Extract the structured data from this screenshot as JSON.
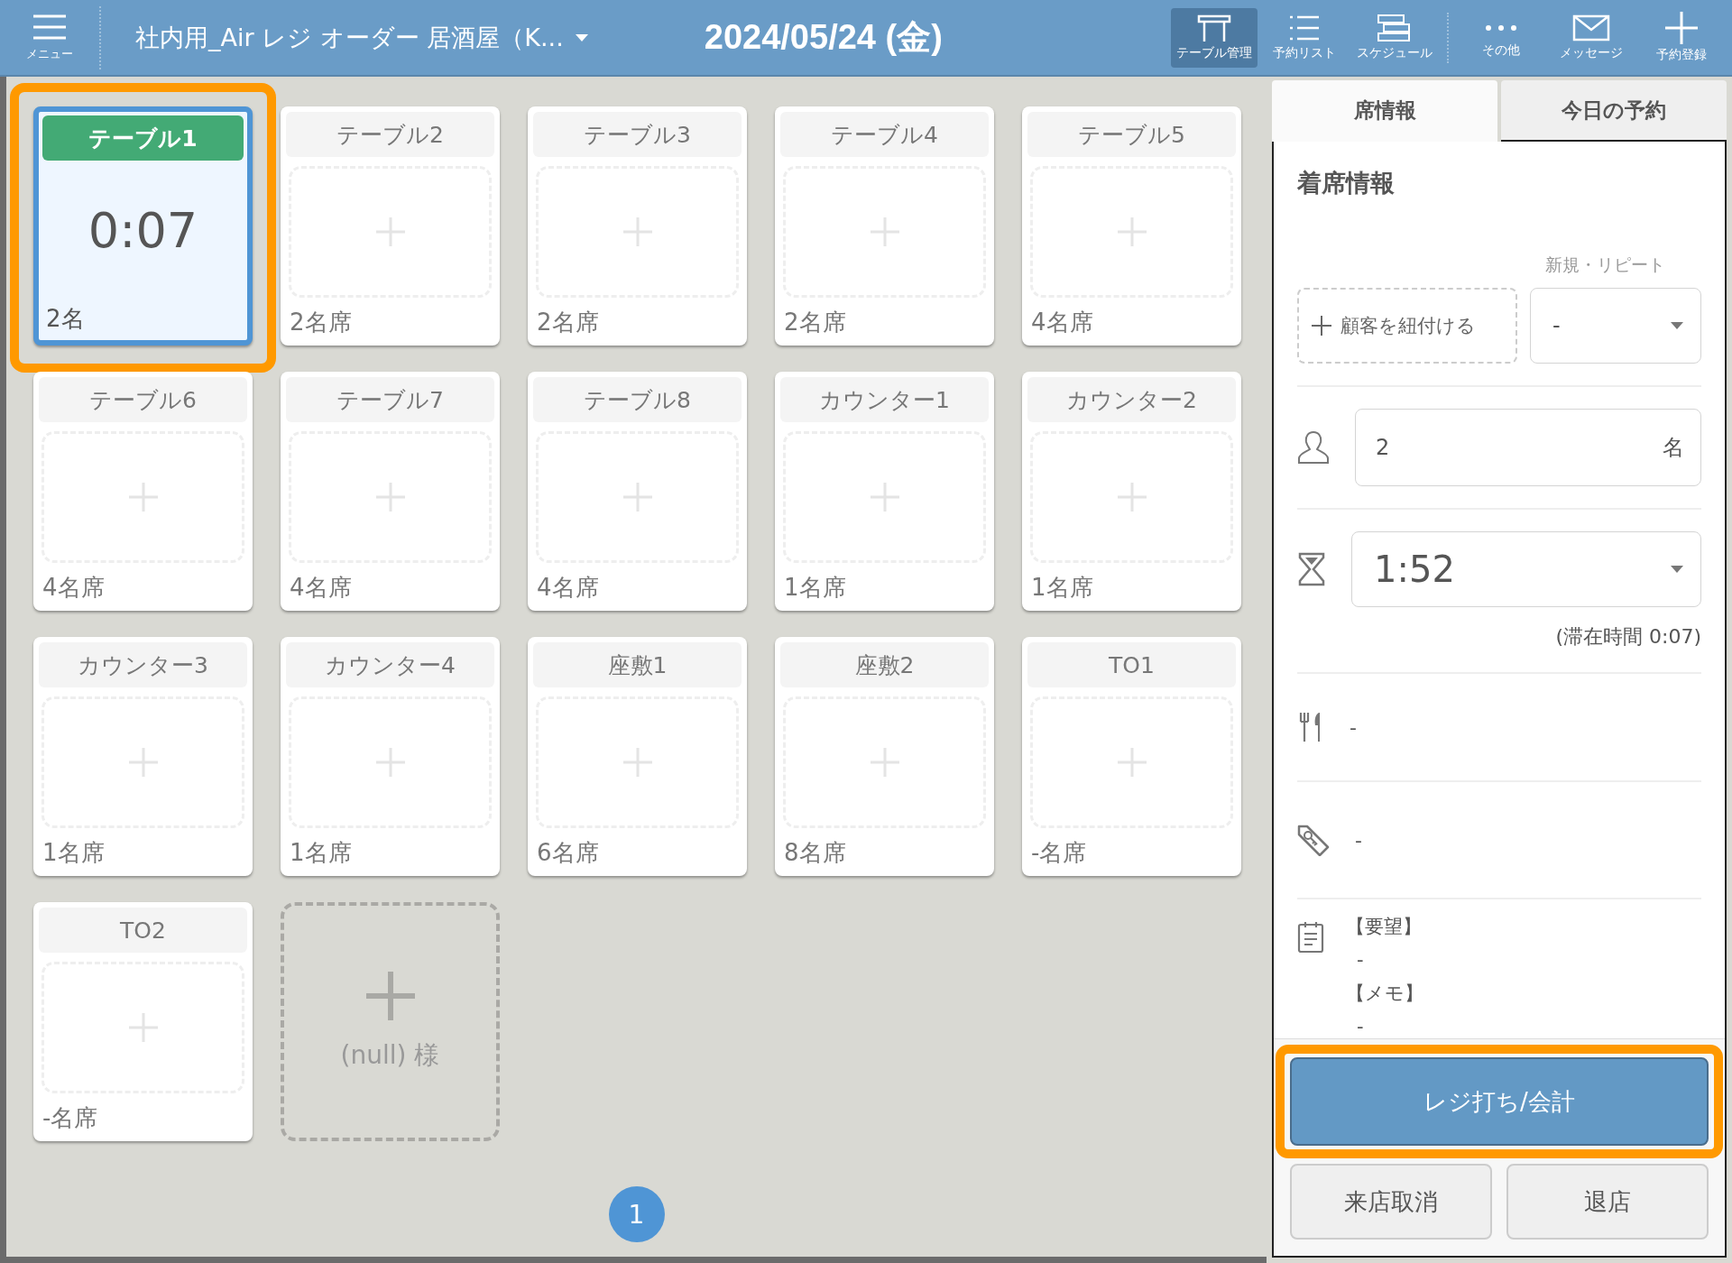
{
  "header": {
    "menu_label": "メニュー",
    "store": "社内用_Air レジ オーダー 居酒屋（K...",
    "date": "2024/05/24 (金)",
    "tools": [
      {
        "label": "テーブル管理",
        "kind": "table",
        "selected": true
      },
      {
        "label": "予約リスト",
        "kind": "list",
        "selected": false
      },
      {
        "label": "スケジュール",
        "kind": "schedule",
        "selected": false
      },
      {
        "label": "その他",
        "kind": "more",
        "selected": false
      },
      {
        "label": "メッセージ",
        "kind": "message",
        "selected": false
      },
      {
        "label": "予約登録",
        "kind": "add",
        "selected": false
      }
    ]
  },
  "tables": [
    {
      "name": "テーブル1",
      "kind": "occupied",
      "elapsed": "0:07",
      "footer": "2名",
      "selected": true,
      "highlighted": true
    },
    {
      "name": "テーブル2",
      "kind": "empty",
      "footer": "2名席",
      "selected": false,
      "highlighted": false
    },
    {
      "name": "テーブル3",
      "kind": "empty",
      "footer": "2名席",
      "selected": false,
      "highlighted": false
    },
    {
      "name": "テーブル4",
      "kind": "empty",
      "footer": "2名席",
      "selected": false,
      "highlighted": false
    },
    {
      "name": "テーブル5",
      "kind": "empty",
      "footer": "4名席",
      "selected": false,
      "highlighted": false
    },
    {
      "name": "テーブル6",
      "kind": "empty",
      "footer": "4名席",
      "selected": false,
      "highlighted": false
    },
    {
      "name": "テーブル7",
      "kind": "empty",
      "footer": "4名席",
      "selected": false,
      "highlighted": false
    },
    {
      "name": "テーブル8",
      "kind": "empty",
      "footer": "4名席",
      "selected": false,
      "highlighted": false
    },
    {
      "name": "カウンター1",
      "kind": "empty",
      "footer": "1名席",
      "selected": false,
      "highlighted": false
    },
    {
      "name": "カウンター2",
      "kind": "empty",
      "footer": "1名席",
      "selected": false,
      "highlighted": false
    },
    {
      "name": "カウンター3",
      "kind": "empty",
      "footer": "1名席",
      "selected": false,
      "highlighted": false
    },
    {
      "name": "カウンター4",
      "kind": "empty",
      "footer": "1名席",
      "selected": false,
      "highlighted": false
    },
    {
      "name": "座敷1",
      "kind": "empty",
      "footer": "6名席",
      "selected": false,
      "highlighted": false
    },
    {
      "name": "座敷2",
      "kind": "empty",
      "footer": "8名席",
      "selected": false,
      "highlighted": false
    },
    {
      "name": "TO1",
      "kind": "empty",
      "footer": "-名席",
      "selected": false,
      "highlighted": false
    },
    {
      "name": "TO2",
      "kind": "empty",
      "footer": "-名席",
      "selected": false,
      "highlighted": false
    }
  ],
  "add_card": {
    "label": "(null) 様"
  },
  "pagination": [
    {
      "label": "1",
      "selected": true
    }
  ],
  "panel": {
    "tabs": [
      {
        "label": "席情報",
        "selected": true
      },
      {
        "label": "今日の予約",
        "selected": false
      }
    ],
    "section_title": "着席情報",
    "repeat_label": "新規・リピート",
    "link_customer": "顧客を紐付ける",
    "repeat_value": "-",
    "guests": {
      "value": "2",
      "unit": "名"
    },
    "duration": "1:52",
    "stay": "(滞在時間 0:07)",
    "course": "-",
    "tag": "-",
    "notes": [
      {
        "label": "【要望】",
        "value": "-"
      },
      {
        "label": "【メモ】",
        "value": "-"
      }
    ],
    "checkout": {
      "label": "レジ打ち/会計",
      "highlighted": true
    },
    "buttons": [
      "来店取消",
      "退店"
    ]
  }
}
